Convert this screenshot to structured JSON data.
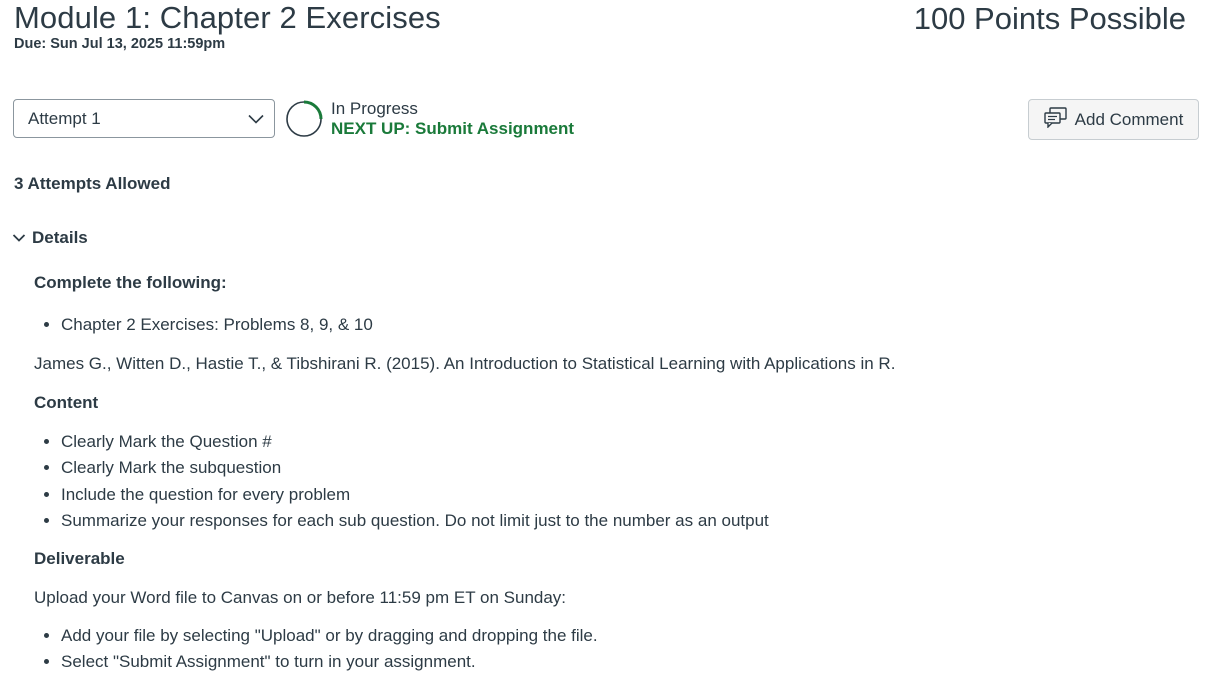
{
  "header": {
    "title": "Module 1: Chapter 2 Exercises",
    "due": "Due: Sun Jul 13, 2025 11:59pm",
    "points": "100 Points Possible"
  },
  "attempt": {
    "selected": "Attempt 1",
    "status": "In Progress",
    "next_up": "NEXT UP: Submit Assignment",
    "allowed": "3 Attempts Allowed"
  },
  "actions": {
    "add_comment": "Add Comment"
  },
  "details": {
    "toggle_label": "Details",
    "heading_complete": "Complete the following:",
    "complete_items": [
      "Chapter 2 Exercises: Problems 8, 9, & 10"
    ],
    "citation": "James G., Witten D., Hastie T., & Tibshirani R. (2015). An Introduction to Statistical Learning with Applications in R.",
    "heading_content": "Content",
    "content_items": [
      "Clearly Mark the Question #",
      "Clearly Mark the subquestion",
      "Include the question for every problem",
      "Summarize your responses for each sub question. Do not limit just to the number as an output"
    ],
    "heading_deliverable": "Deliverable",
    "deliverable_intro": "Upload your Word file to Canvas on or before 11:59 pm ET on Sunday:",
    "deliverable_items": [
      "Add your file by selecting \"Upload\" or by dragging and dropping the file.",
      "Select \"Submit Assignment\" to turn in your assignment."
    ]
  },
  "colors": {
    "text": "#2d3b45",
    "success": "#1a7a3a",
    "border": "#8b969e",
    "button_bg": "#f5f5f5"
  },
  "icons": {
    "select_chevron": "chevron-down-icon",
    "progress": "progress-ring-icon",
    "comment": "comment-icon",
    "details_toggle": "chevron-down-icon"
  }
}
